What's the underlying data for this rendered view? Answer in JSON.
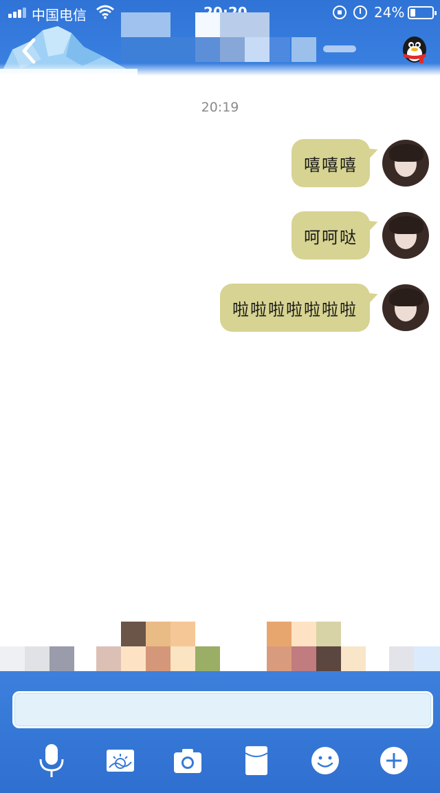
{
  "status_bar": {
    "carrier": "中国电信",
    "time": "20:20",
    "battery_percent": "24%",
    "battery_level": 0.24
  },
  "header": {
    "back_icon": "chevron-left-icon",
    "profile_icon": "qq-penguin-icon"
  },
  "chat": {
    "timestamp": "20:19",
    "messages": [
      {
        "text": "嘻嘻嘻",
        "sender": "me"
      },
      {
        "text": "呵呵哒",
        "sender": "me"
      },
      {
        "text": "啦啦啦啦啦啦啦",
        "sender": "me"
      }
    ]
  },
  "composer": {
    "value": "",
    "placeholder": ""
  },
  "toolbar": {
    "items": [
      {
        "name": "voice",
        "icon": "microphone-icon"
      },
      {
        "name": "photo",
        "icon": "image-icon"
      },
      {
        "name": "camera",
        "icon": "camera-icon"
      },
      {
        "name": "red-packet",
        "icon": "red-packet-icon"
      },
      {
        "name": "emoji",
        "icon": "smiley-icon"
      },
      {
        "name": "more",
        "icon": "plus-icon"
      }
    ]
  },
  "colors": {
    "header_blue": "#3b82e2",
    "bubble": "#d7d392",
    "panel_blue": "#3579d8",
    "input_bg": "#e3f1fb"
  }
}
